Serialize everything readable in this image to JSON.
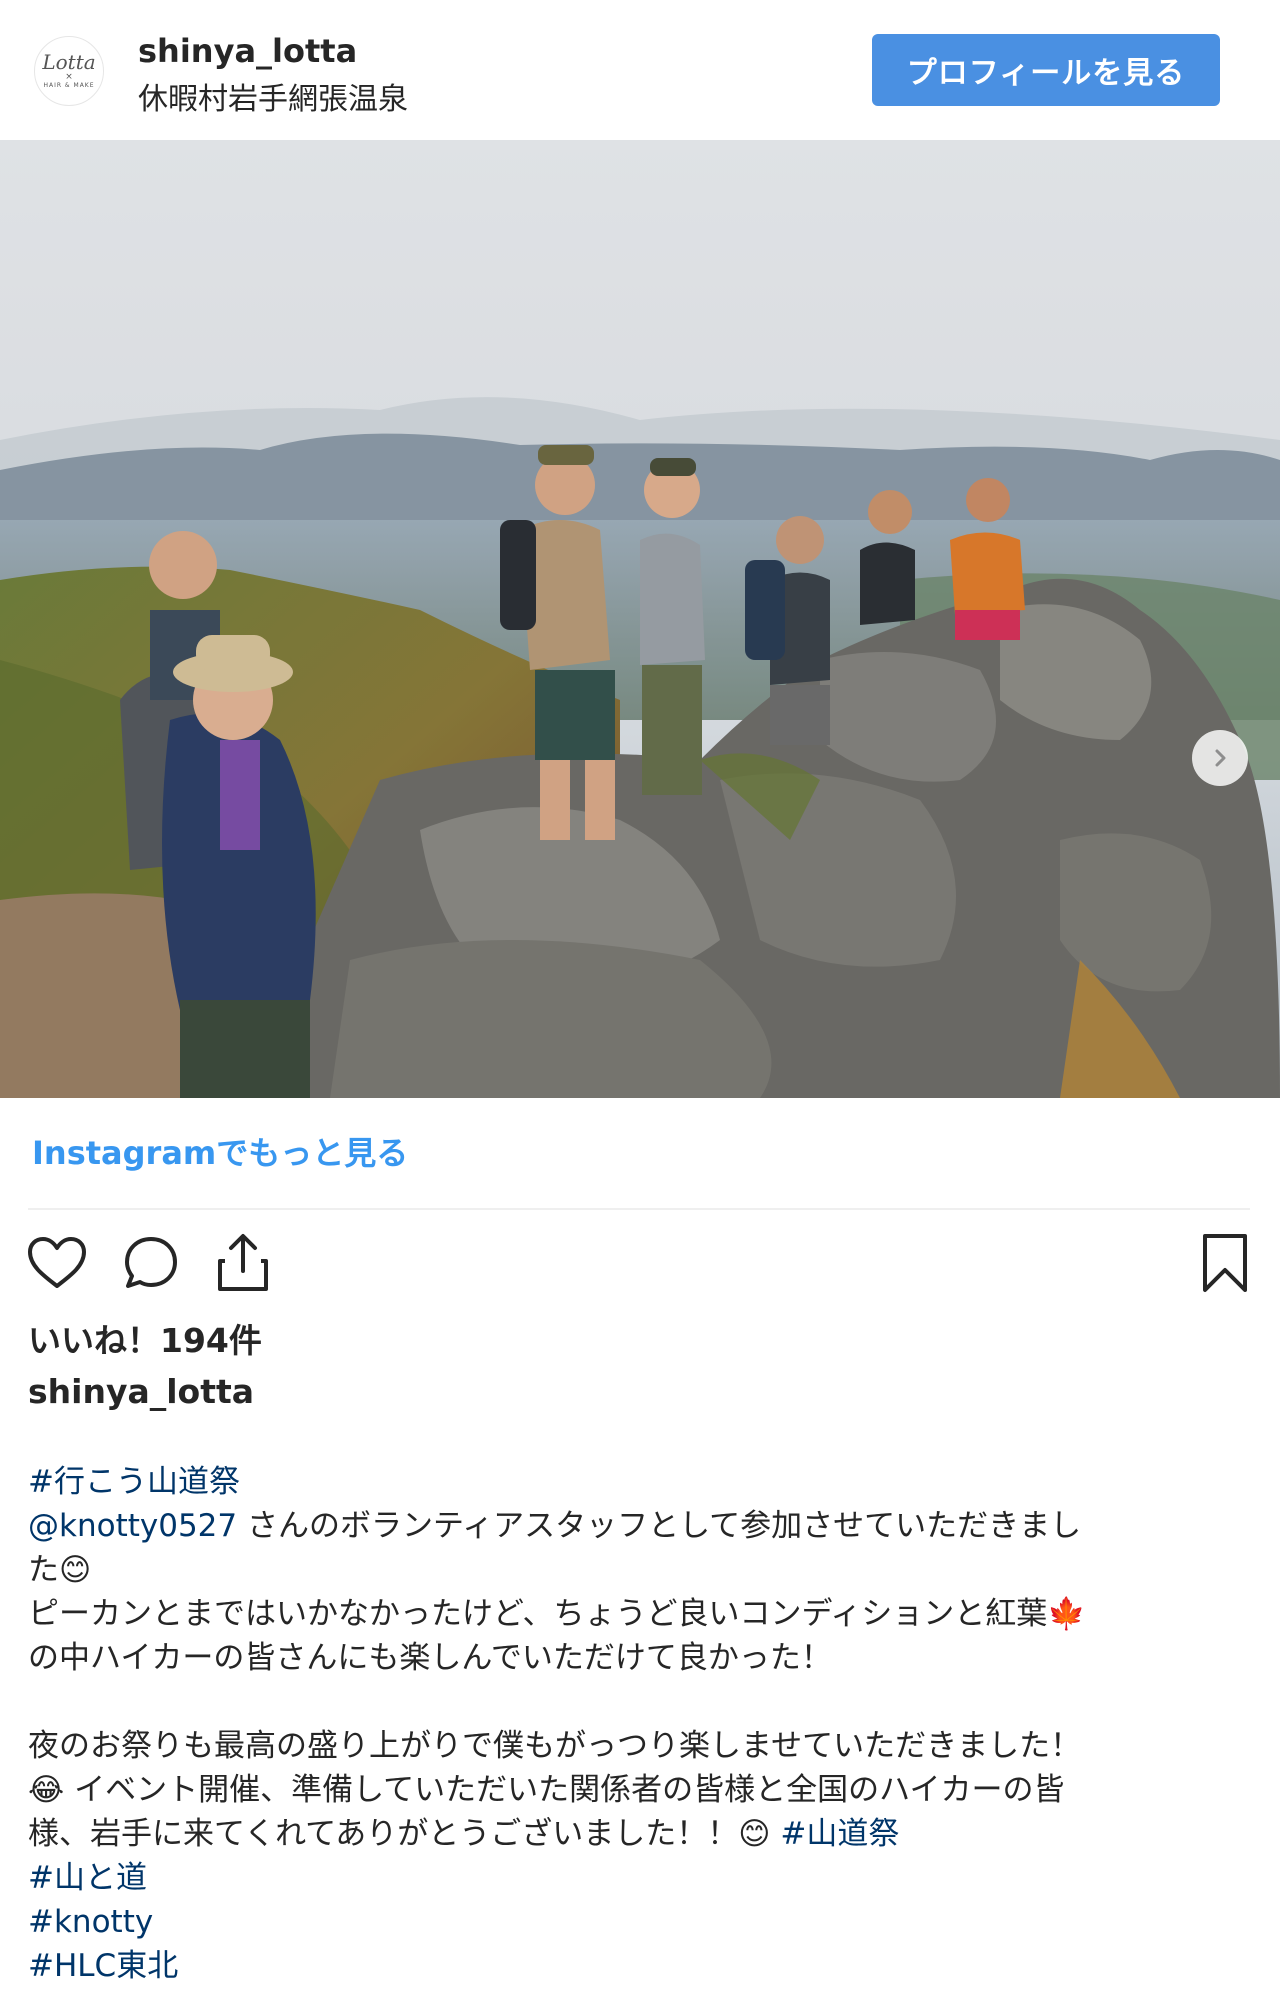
{
  "header": {
    "avatar_logo": "Lotta",
    "avatar_sub": "HAIR & MAKE",
    "username": "shinya_lotta",
    "location": "休暇村岩手網張温泉",
    "profile_button": "プロフィールを見る"
  },
  "photo": {
    "description_icon": "carousel-photo",
    "next_icon": "chevron-right-icon"
  },
  "more_link": "Instagramでもっと見る",
  "actions": {
    "like_icon": "heart-icon",
    "comment_icon": "comment-icon",
    "share_icon": "share-icon",
    "save_icon": "bookmark-icon"
  },
  "likes": "いいね！194件",
  "caption": {
    "username": "shinya_lotta",
    "tag1": "#行こう山道祭",
    "mention": "@knotty0527",
    "line2_rest": " さんのボランティアスタッフとして参加させていただきまし",
    "line3": "た😊",
    "line4": "ピーカンとまではいかなかったけど、ちょうど良いコンディションと紅葉🍁",
    "line5": "の中ハイカーの皆さんにも楽しんでいただけて良かった！",
    "line7": "夜のお祭りも最高の盛り上がりで僕もがっつり楽しませていただきました！",
    "line8": "😂 イベント開催、準備していただいた関係者の皆様と全国のハイカーの皆",
    "line9_text": "様、岩手に来てくれてありがとうございました！！😊 ",
    "line9_tag": "#山道祭",
    "tag_mountain": "#山と道",
    "tag_knotty": "#knotty",
    "tag_hlc": "#HLC東北"
  },
  "colors": {
    "accent": "#4a90e2",
    "link": "#3897f0",
    "hashtag": "#003569"
  }
}
